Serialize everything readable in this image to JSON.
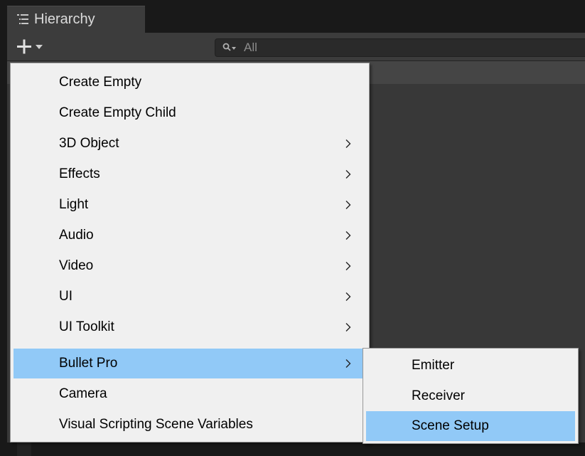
{
  "panel": {
    "tab_title": "Hierarchy",
    "tab_icon": "list-icon",
    "add_icon": "plus-dropdown-icon",
    "search_icon": "search-filter-icon",
    "search_placeholder": "All"
  },
  "context_menu": {
    "items": [
      {
        "label": "Create Empty",
        "has_submenu": false
      },
      {
        "label": "Create Empty Child",
        "has_submenu": false
      },
      {
        "label": "3D Object",
        "has_submenu": true
      },
      {
        "label": "Effects",
        "has_submenu": true
      },
      {
        "label": "Light",
        "has_submenu": true
      },
      {
        "label": "Audio",
        "has_submenu": true
      },
      {
        "label": "Video",
        "has_submenu": true
      },
      {
        "label": "UI",
        "has_submenu": true
      },
      {
        "label": "UI Toolkit",
        "has_submenu": true
      },
      {
        "label": "Bullet Pro",
        "has_submenu": true,
        "highlighted": true
      },
      {
        "label": "Camera",
        "has_submenu": false
      },
      {
        "label": "Visual Scripting Scene Variables",
        "has_submenu": false
      }
    ]
  },
  "submenu": {
    "parent": "Bullet Pro",
    "items": [
      {
        "label": "Emitter"
      },
      {
        "label": "Receiver"
      },
      {
        "label": "Scene Setup",
        "highlighted": true
      }
    ]
  },
  "colors": {
    "menu_background": "#f0f0f0",
    "highlight": "#91c9f7",
    "panel_background": "#383838",
    "toolbar_background": "#3c3c3c"
  }
}
